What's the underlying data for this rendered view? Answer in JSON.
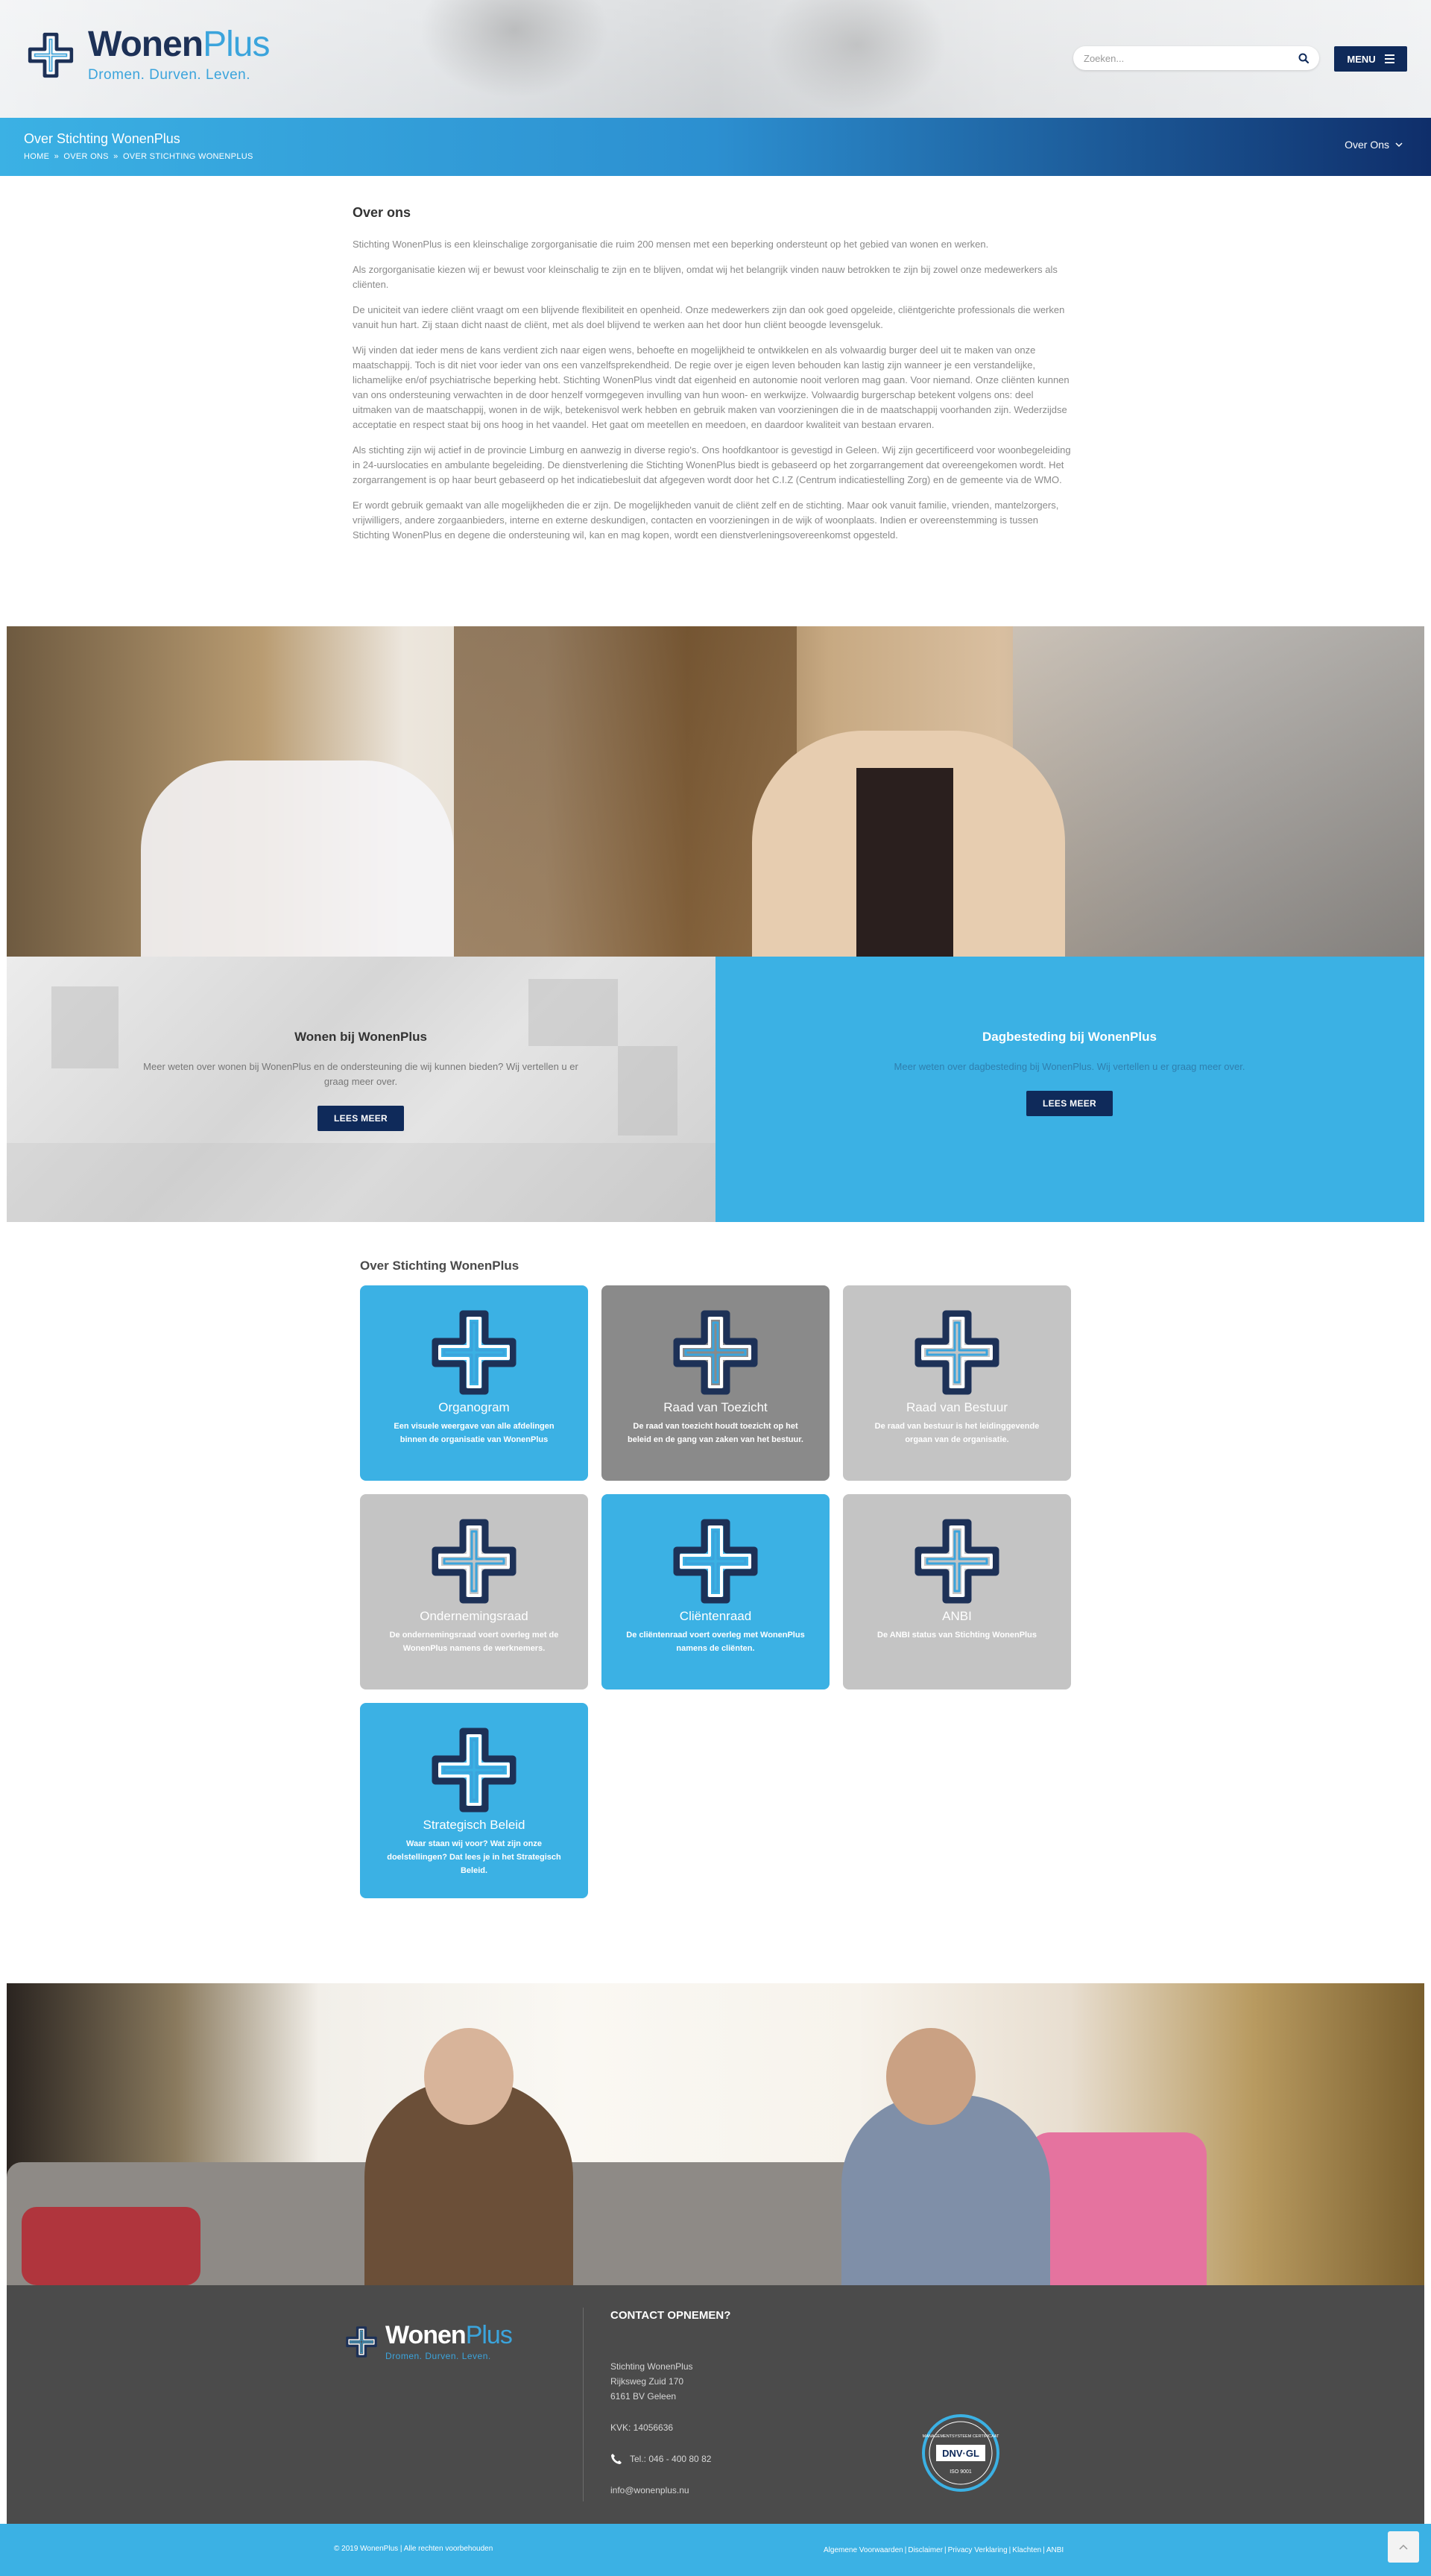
{
  "header": {
    "logo": {
      "name_main": "Wonen",
      "name_accent": "Plus",
      "tagline": "Dromen. Durven. Leven."
    },
    "search": {
      "placeholder": "Zoeken..."
    },
    "menu_label": "MENU"
  },
  "titlebar": {
    "title": "Over Stichting WonenPlus",
    "breadcrumb": [
      "HOME",
      "OVER ONS",
      "OVER STICHTING WONENPLUS"
    ],
    "breadcrumb_sep": "»",
    "dropdown_label": "Over Ons"
  },
  "article": {
    "heading": "Over ons",
    "paragraphs": [
      "Stichting WonenPlus is een kleinschalige zorgorganisatie die ruim 200 mensen met een beperking ondersteunt op het gebied van wonen en werken.",
      "Als zorgorganisatie kiezen wij er bewust voor kleinschalig te zijn en te blijven, omdat wij het belangrijk vinden nauw betrokken te zijn bij zowel onze medewerkers als cliënten.",
      "De uniciteit van iedere cliënt vraagt om een blijvende flexibiliteit en openheid. Onze medewerkers zijn dan ook goed opgeleide, cliëntgerichte professionals die werken vanuit hun hart. Zij staan dicht naast de cliënt, met als doel blijvend te werken aan het door hun cliënt beoogde levensgeluk.",
      "Wij vinden dat ieder mens de kans verdient zich naar eigen wens, behoefte en mogelijkheid te ontwikkelen en als volwaardig burger deel uit te maken van onze maatschappij. Toch is dit niet voor ieder van ons een vanzelfsprekendheid. De regie over je eigen leven behouden kan lastig zijn wanneer je een verstandelijke, lichamelijke en/of psychiatrische beperking hebt. Stichting WonenPlus vindt dat eigenheid en autonomie nooit verloren mag gaan. Voor niemand. Onze cliënten kunnen van ons ondersteuning verwachten in de door henzelf vormgegeven invulling van hun woon- en werkwijze. Volwaardig burgerschap betekent volgens ons: deel uitmaken van de maatschappij, wonen in de wijk, betekenisvol werk hebben en gebruik maken van voorzieningen die in de maatschappij voorhanden zijn. Wederzijdse acceptatie en respect staat bij ons hoog in het vaandel. Het gaat om meetellen en meedoen, en daardoor kwaliteit van bestaan ervaren.",
      "Als stichting zijn wij actief in de provincie Limburg en aanwezig in diverse regio's. Ons hoofdkantoor is gevestigd in Geleen. Wij zijn gecertificeerd voor woonbegeleiding in 24-uurslocaties en ambulante begeleiding. De dienstverlening die Stichting WonenPlus biedt is gebaseerd op het zorgarrangement dat overeengekomen wordt. Het zorgarrangement is op haar beurt gebaseerd op het indicatiebesluit dat afgegeven wordt door het C.I.Z (Centrum indicatiestelling Zorg) en de gemeente via de WMO.",
      "Er wordt gebruik gemaakt van alle mogelijkheden die er zijn. De mogelijkheden vanuit de cliënt zelf en de stichting. Maar ook vanuit familie, vrienden, mantelzorgers, vrijwilligers, andere zorgaanbieders, interne en externe deskundigen, contacten en voorzieningen in de wijk of woonplaats. Indien er overeenstemming is tussen Stichting WonenPlus en degene die ondersteuning wil, kan en mag kopen, wordt een dienstverleningsovereenkomst opgesteld."
    ]
  },
  "split": {
    "left": {
      "title": "Wonen bij WonenPlus",
      "text": "Meer weten over wonen bij WonenPlus en de ondersteuning die wij kunnen bieden? Wij vertellen u er graag meer over.",
      "button": "LEES MEER"
    },
    "right": {
      "title": "Dagbesteding bij WonenPlus",
      "text": "Meer weten over dagbesteding bij WonenPlus. Wij vertellen u er graag meer over.",
      "button": "LEES MEER"
    }
  },
  "tiles_section": {
    "title": "Over Stichting WonenPlus",
    "tiles": [
      {
        "title": "Organogram",
        "text": "Een visuele weergave van alle afdelingen binnen de organisatie van WonenPlus"
      },
      {
        "title": "Raad van Toezicht",
        "text": "De raad van toezicht houdt toezicht op het beleid en de gang van zaken van het bestuur."
      },
      {
        "title": "Raad van Bestuur",
        "text": "De raad van bestuur is het leidinggevende orgaan van de organisatie."
      },
      {
        "title": "Ondernemingsraad",
        "text": "De ondernemingsraad voert overleg met de WonenPlus namens de werknemers."
      },
      {
        "title": "Cliëntenraad",
        "text": "De cliëntenraad voert overleg met WonenPlus namens de cliënten."
      },
      {
        "title": "ANBI",
        "text": "De ANBI status van Stichting WonenPlus"
      },
      {
        "title": "Strategisch Beleid",
        "text": "Waar staan wij voor? Wat zijn onze doelstellingen? Dat lees je in het Strategisch Beleid."
      }
    ]
  },
  "footer": {
    "logo": {
      "name_main": "Wonen",
      "name_accent": "Plus",
      "tagline": "Dromen. Durven. Leven."
    },
    "contact_heading": "CONTACT OPNEMEN?",
    "org": "Stichting WonenPlus",
    "street": "Rijksweg Zuid 170",
    "city": "6161 BV Geleen",
    "kvk": "KVK: 14056636",
    "phone": "Tel.: 046 - 400 80 82",
    "email": "info@wonenplus.nu",
    "badge": {
      "ring_text": "MANAGEMENTSYSTEEM CERTIFICAAT",
      "brand": "DNV·GL",
      "standard": "ISO 9001"
    }
  },
  "bottombar": {
    "copyright": "© 2019 WonenPlus | Alle rechten voorbehouden",
    "links": [
      "Algemene Voorwaarden",
      "Disclaimer",
      "Privacy Verklaring",
      "Klachten",
      "ANBI"
    ],
    "link_sep": "|"
  },
  "colors": {
    "brand_blue": "#3bb1e4",
    "navy": "#0f2a5a",
    "footer_grey": "#4b4b4b"
  },
  "icons": {
    "search": "search-icon",
    "menu": "hamburger-icon",
    "chevron": "chevron-down-icon",
    "phone": "phone-icon",
    "to_top": "chevron-up-icon",
    "tile": "wonenplus-cross-icon"
  }
}
